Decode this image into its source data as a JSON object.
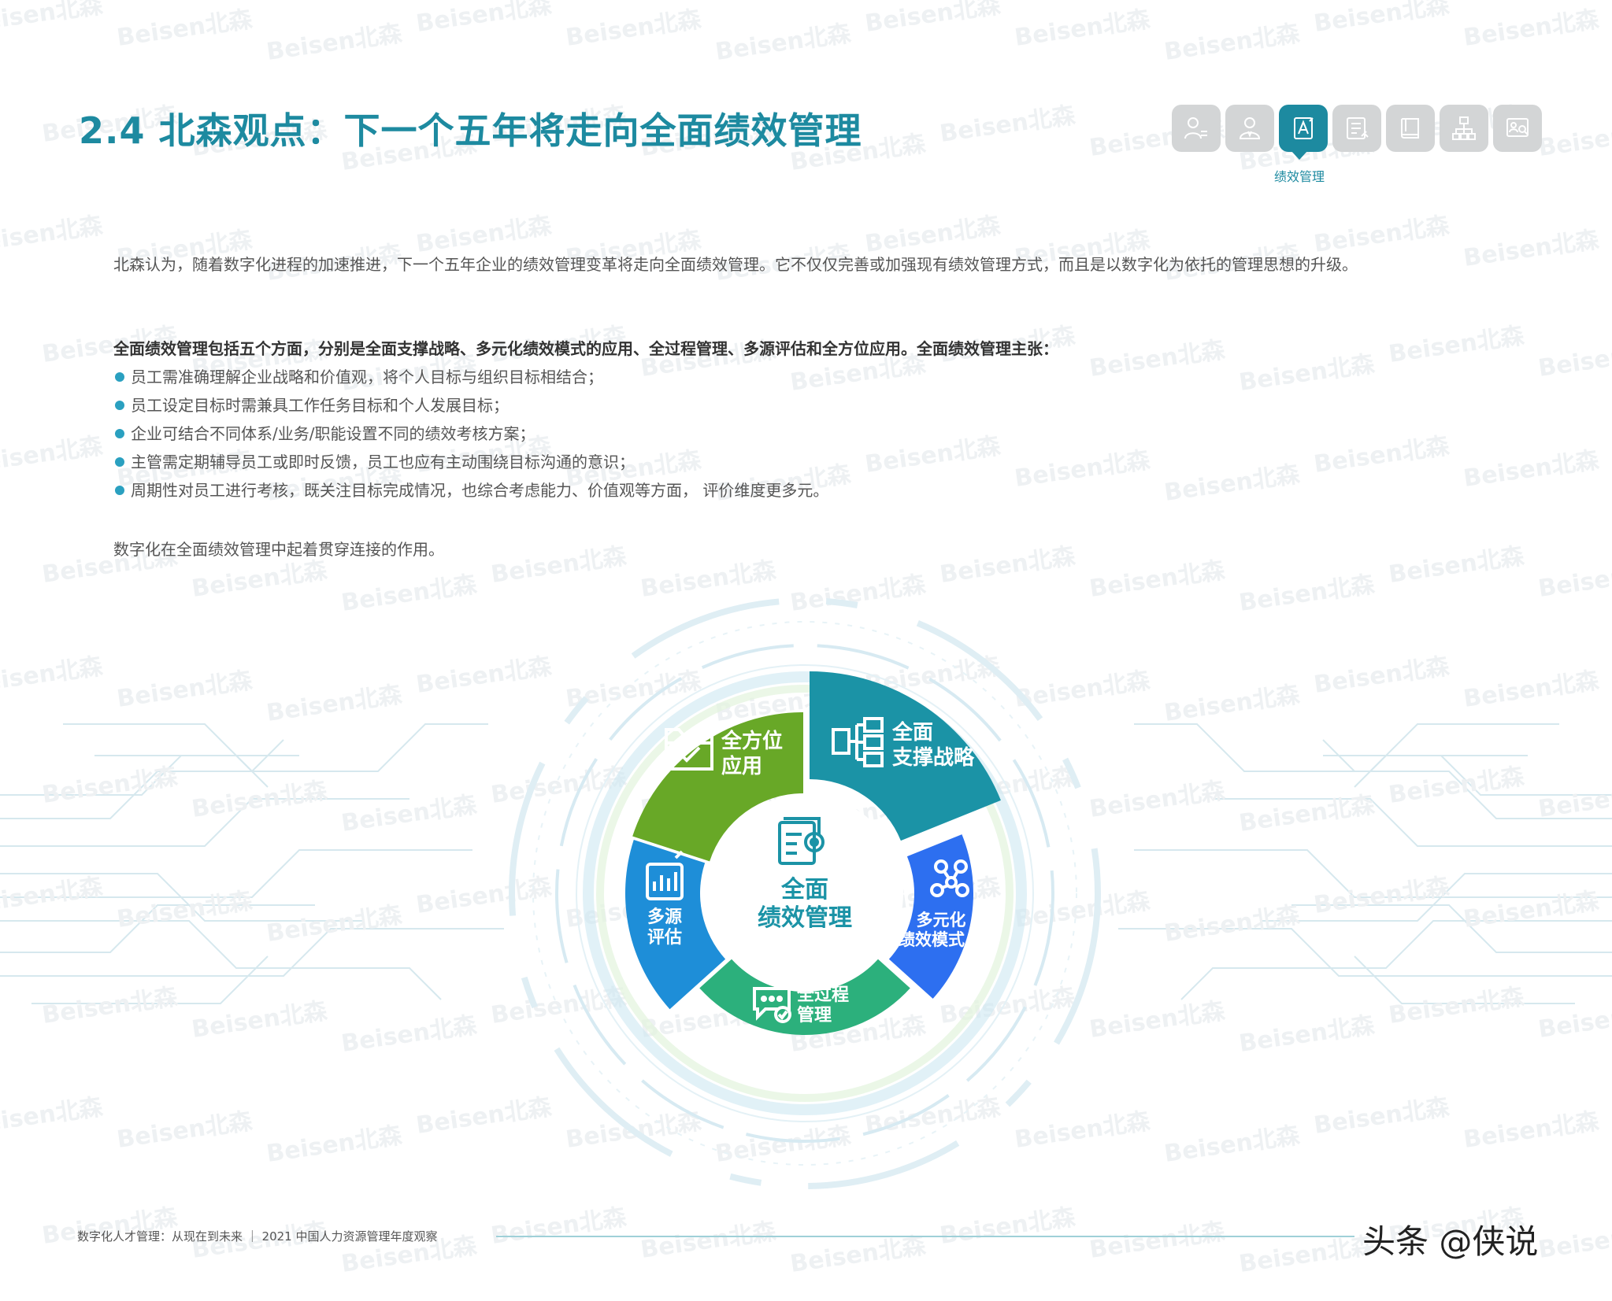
{
  "watermark": "Beisen北森",
  "title": "2.4 北森观点：下一个五年将走向全面绩效管理",
  "nav": {
    "active_label": "绩效管理",
    "icons": [
      "person-list-icon",
      "person-icon",
      "performance-icon",
      "form-list-icon",
      "book-icon",
      "org-chart-icon",
      "profile-search-icon"
    ]
  },
  "intro": "北森认为，随着数字化进程的加速推进，下一个五年企业的绩效管理变革将走向全面绩效管理。它不仅仅完善或加强现有绩效管理方式，而且是以数字化为依托的管理思想的升级。",
  "aspects_heading": "全面绩效管理包括五个方面，分别是全面支撑战略、多元化绩效模式的应用、全过程管理、多源评估和全方位应用。全面绩效管理主张：",
  "bullets": [
    "员工需准确理解企业战略和价值观，将个人目标与组织目标相结合；",
    "员工设定目标时需兼具工作任务目标和个人发展目标；",
    "企业可结合不同体系/业务/职能设置不同的绩效考核方案；",
    "主管需定期辅导员工或即时反馈，员工也应有主动围绕目标沟通的意识；",
    "周期性对员工进行考核，既关注目标完成情况，也综合考虑能力、价值观等方面， 评价维度更多元。"
  ],
  "closing": "数字化在全面绩效管理中起着贯穿连接的作用。",
  "diagram": {
    "center": {
      "line1": "全面",
      "line2": "绩效管理"
    },
    "segments": [
      {
        "line1": "全面",
        "line2": "支撑战略",
        "color": "#1b93a6",
        "icon": "hierarchy-icon"
      },
      {
        "line1": "多元化",
        "line2": "绩效模式",
        "color": "#2d6ff0",
        "icon": "molecule-icon"
      },
      {
        "line1": "全过程",
        "line2": "管理",
        "color": "#2cb07c",
        "icon": "chat-check-icon"
      },
      {
        "line1": "多源",
        "line2": "评估",
        "color": "#1e8ed8",
        "icon": "chart-board-icon"
      },
      {
        "line1": "全方位",
        "line2": "应用",
        "color": "#68a827",
        "icon": "folder-check-icon"
      }
    ]
  },
  "footer": "数字化人才管理：从现在到未来 ｜ 2021 中国人力资源管理年度观察",
  "credit": "头条 @侠说"
}
